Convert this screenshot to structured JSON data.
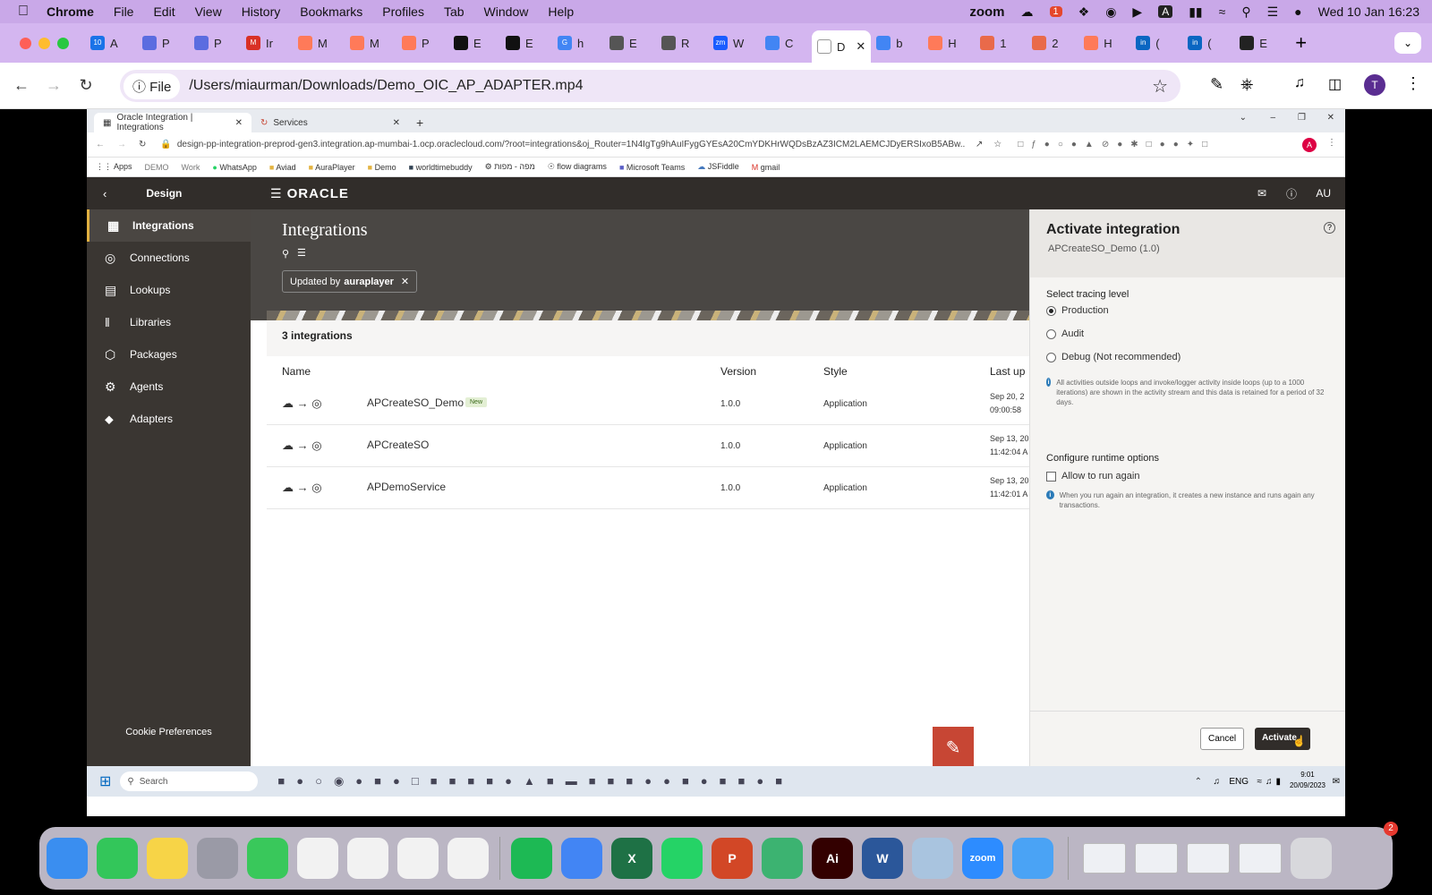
{
  "menubar": {
    "app": "Chrome",
    "items": [
      "File",
      "Edit",
      "View",
      "History",
      "Bookmarks",
      "Profiles",
      "Tab",
      "Window",
      "Help"
    ],
    "zoom": "zoom",
    "clock": "Wed 10 Jan  16:23",
    "badge": "1"
  },
  "tabs": [
    {
      "label": "A",
      "color": "#1a73e8",
      "text": "10"
    },
    {
      "label": "P",
      "color": "#5b6ce0"
    },
    {
      "label": "P",
      "color": "#5b6ce0"
    },
    {
      "label": "Ir",
      "color": "#d93025",
      "text": "M"
    },
    {
      "label": "M",
      "color": "#ff7a59"
    },
    {
      "label": "M",
      "color": "#ff7a59"
    },
    {
      "label": "P",
      "color": "#ff7a59"
    },
    {
      "label": "E",
      "color": "#111"
    },
    {
      "label": "E",
      "color": "#111"
    },
    {
      "label": "h",
      "color": "#4285f4",
      "text": "G"
    },
    {
      "label": "E",
      "color": "#555"
    },
    {
      "label": "R",
      "color": "#555"
    },
    {
      "label": "W",
      "color": "#1a5cff",
      "text": "zm"
    },
    {
      "label": "C",
      "color": "#4285f4"
    },
    {
      "label": "D",
      "color": "#fff",
      "active": true
    },
    {
      "label": "b",
      "color": "#4285f4"
    },
    {
      "label": "H",
      "color": "#ff7a59"
    },
    {
      "label": "1",
      "color": "#e96a4a"
    },
    {
      "label": "2",
      "color": "#e96a4a"
    },
    {
      "label": "H",
      "color": "#ff7a59"
    },
    {
      "label": "(",
      "color": "#0a66c2",
      "text": "in"
    },
    {
      "label": "(",
      "color": "#0a66c2",
      "text": "in"
    },
    {
      "label": "E",
      "color": "#222"
    }
  ],
  "omnibox": {
    "chip": "File",
    "url": "/Users/miaurman/Downloads/Demo_OIC_AP_ADAPTER.mp4"
  },
  "profile_initial": "T",
  "inner": {
    "tab1": "Oracle Integration | Integrations",
    "tab2": "Services",
    "address": "design-pp-integration-preprod-gen3.integration.ap-mumbai-1.ocp.oraclecloud.com/?root=integrations&oj_Router=1N4IgTg9hAuIFygGYEsA20CmYDKHrWQDsBzAZ3ICM2LAEMCJDyERSIxoB5ABw...",
    "bookmarks": [
      "Apps",
      "DEMO",
      "Work",
      "WhatsApp",
      "Aviad",
      "AuraPlayer",
      "Demo",
      "worldtimebuddy",
      "מפה - מפות",
      "flow diagrams",
      "Microsoft Teams",
      "JSFiddle",
      "gmail"
    ],
    "profile": "A"
  },
  "oracle": {
    "logo": "ORACLE",
    "user": "AU",
    "back_label": "Design",
    "nav": [
      {
        "label": "Integrations",
        "icon": "integrations-icon",
        "selected": true
      },
      {
        "label": "Connections",
        "icon": "connections-icon"
      },
      {
        "label": "Lookups",
        "icon": "lookups-icon"
      },
      {
        "label": "Libraries",
        "icon": "libraries-icon"
      },
      {
        "label": "Packages",
        "icon": "packages-icon"
      },
      {
        "label": "Agents",
        "icon": "agents-icon"
      },
      {
        "label": "Adapters",
        "icon": "adapters-icon"
      }
    ],
    "cookie": "Cookie Preferences",
    "page_title": "Integrations",
    "filter_chip_prefix": "Updated by",
    "filter_chip_value": "auraplayer",
    "count_label": "3 integrations",
    "columns": {
      "name": "Name",
      "version": "Version",
      "style": "Style",
      "last": "Last up"
    },
    "rows": [
      {
        "name": "APCreateSO_Demo",
        "badge": "New",
        "version": "1.0.0",
        "style": "Application",
        "date": "Sep 20, 2",
        "time": "09:00:58"
      },
      {
        "name": "APCreateSO",
        "badge": "",
        "version": "1.0.0",
        "style": "Application",
        "date": "Sep 13, 20",
        "time": "11:42:04 A"
      },
      {
        "name": "APDemoService",
        "badge": "",
        "version": "1.0.0",
        "style": "Application",
        "date": "Sep 13, 20",
        "time": "11:42:01 A"
      }
    ]
  },
  "drawer": {
    "title": "Activate integration",
    "subtitle": "APCreateSO_Demo (1.0)",
    "tracing_label": "Select tracing level",
    "options": [
      {
        "label": "Production",
        "checked": true
      },
      {
        "label": "Audit",
        "checked": false
      },
      {
        "label": "Debug (Not recommended)",
        "checked": false
      }
    ],
    "debug_help": "All activities outside loops and invoke/logger activity inside loops (up to a 1000 iterations) are shown in the activity stream and this data is retained for a period of 32 days.",
    "runtime_label": "Configure runtime options",
    "allow_label": "Allow to run again",
    "allow_checked": false,
    "allow_help": "When you run again an integration, it creates a new instance and runs again any transactions.",
    "cancel": "Cancel",
    "activate": "Activate"
  },
  "windows_taskbar": {
    "search": "Search",
    "lang": "ENG",
    "time": "9:01",
    "date": "20/09/2023"
  },
  "dock": {
    "mail_badge": "2",
    "apps": [
      {
        "name": "finder-icon",
        "color": "#3a8ef0",
        "text": ""
      },
      {
        "name": "facetime-icon",
        "color": "#33c65a",
        "text": ""
      },
      {
        "name": "notes-icon",
        "color": "#f7d447",
        "text": ""
      },
      {
        "name": "launchpad-icon",
        "color": "#9a9aa6",
        "text": ""
      },
      {
        "name": "messages-icon",
        "color": "#39c85b",
        "text": ""
      },
      {
        "name": "reminders-icon",
        "color": "#f2f2f2",
        "text": ""
      },
      {
        "name": "pages-icon",
        "color": "#f2f2f2",
        "text": ""
      },
      {
        "name": "numbers-icon",
        "color": "#f2f2f2",
        "text": ""
      },
      {
        "name": "keynote-icon",
        "color": "#f2f2f2",
        "text": ""
      },
      {
        "name": "spotify-icon",
        "color": "#1db954",
        "text": ""
      },
      {
        "name": "chrome-icon",
        "color": "#4285f4",
        "text": ""
      },
      {
        "name": "excel-icon",
        "color": "#1e7145",
        "text": "X"
      },
      {
        "name": "whatsapp-icon",
        "color": "#25d366",
        "text": ""
      },
      {
        "name": "powerpoint-icon",
        "color": "#d24726",
        "text": "P"
      },
      {
        "name": "vpn-icon",
        "color": "#3cb371",
        "text": ""
      },
      {
        "name": "illustrator-icon",
        "color": "#330000",
        "text": "Ai"
      },
      {
        "name": "word-icon",
        "color": "#2b579a",
        "text": "W"
      },
      {
        "name": "preview-icon",
        "color": "#a9c4df",
        "text": ""
      },
      {
        "name": "zoom-icon",
        "color": "#2d8cff",
        "text": "zoom"
      },
      {
        "name": "mail-icon",
        "color": "#4aa3f5",
        "text": ""
      }
    ]
  }
}
